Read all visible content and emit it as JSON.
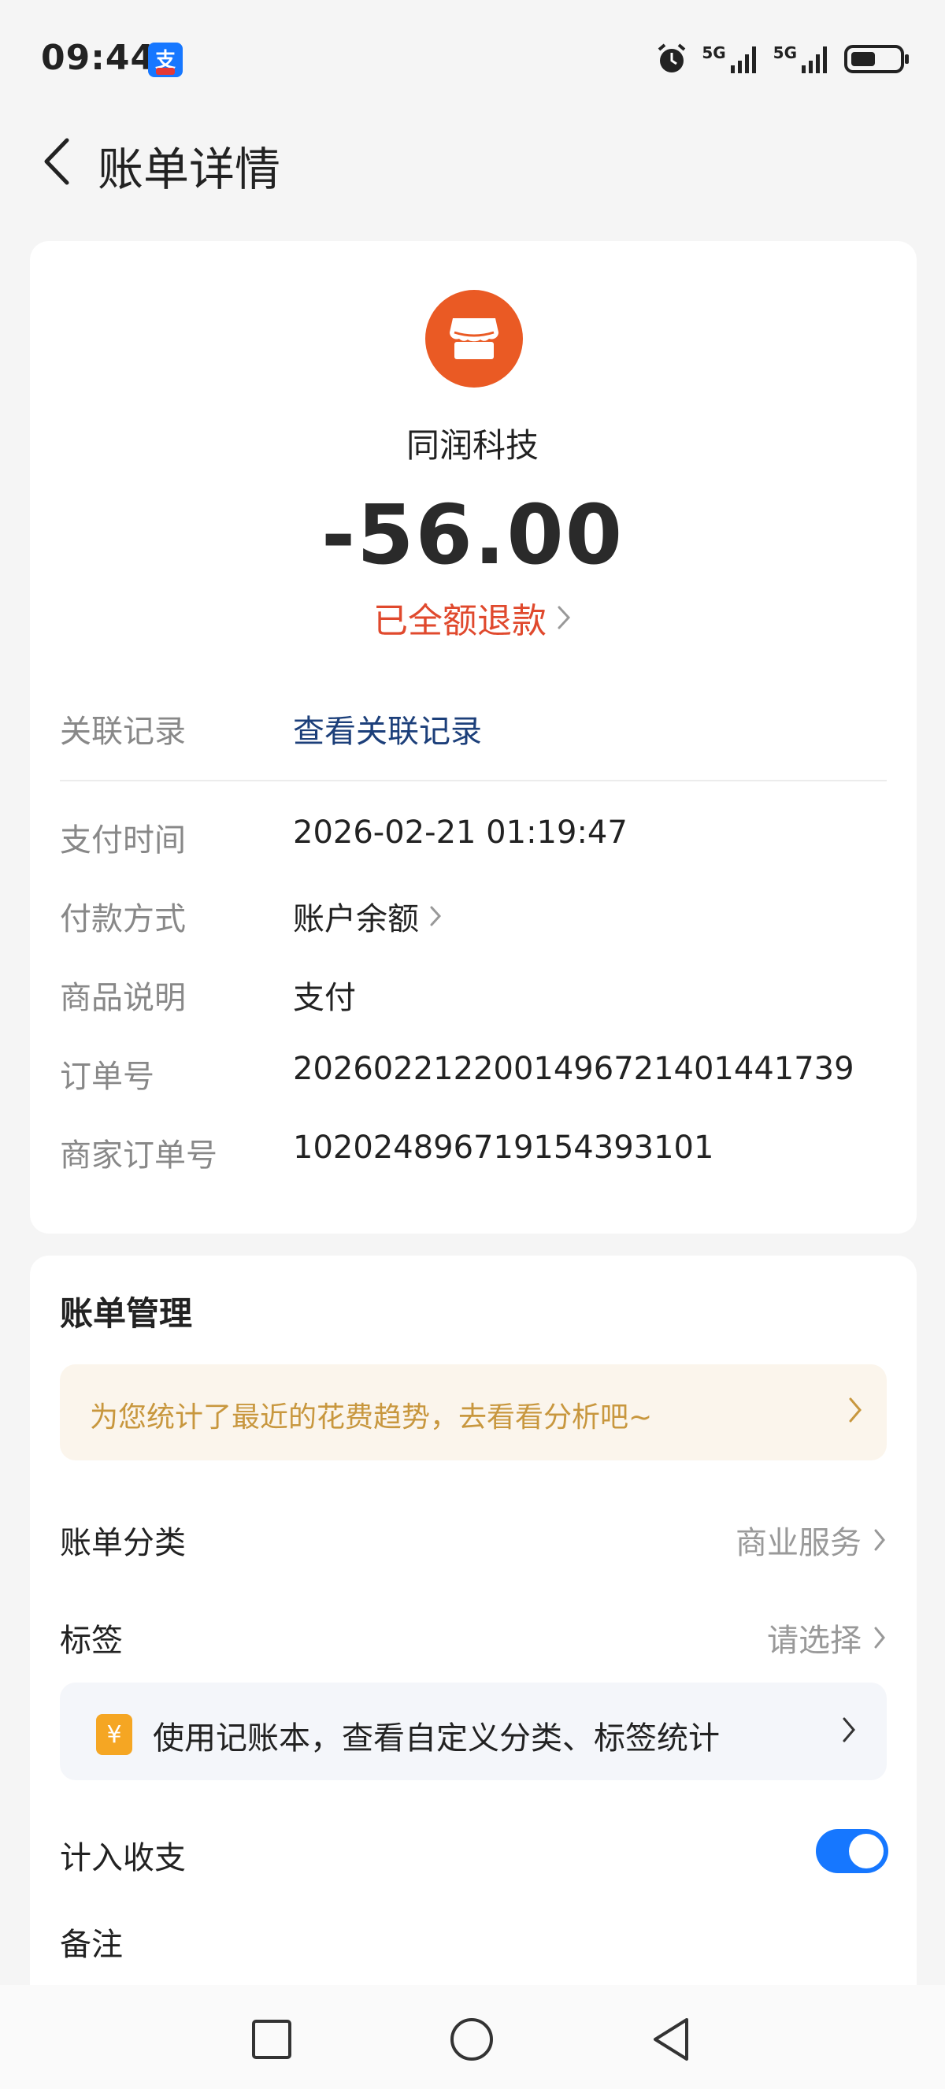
{
  "status_bar": {
    "time": "09:44",
    "app_badge_label": "支",
    "signal_1": "5G",
    "signal_2": "5G"
  },
  "header": {
    "title": "账单详情"
  },
  "bill": {
    "merchant_name": "同润科技",
    "amount": "-56.00",
    "refund_status": "已全额退款",
    "related_label": "关联记录",
    "related_value": "查看关联记录",
    "details": [
      {
        "label": "支付时间",
        "value": "2026-02-21 01:19:47"
      },
      {
        "label": "付款方式",
        "value": "账户余额"
      },
      {
        "label": "商品说明",
        "value": "支付"
      },
      {
        "label": "订单号",
        "value": "2026022122001496721401441739"
      },
      {
        "label": "商家订单号",
        "value": "102024896719154393101"
      }
    ]
  },
  "management": {
    "title": "账单管理",
    "trend_tip": "为您统计了最近的花费趋势，去看看分析吧~",
    "category_label": "账单分类",
    "category_value": "商业服务",
    "tag_label": "标签",
    "tag_value": "请选择",
    "promo_text": "使用记账本，查看自定义分类、标签统计",
    "promo_icon_glyph": "¥",
    "include_label": "计入收支",
    "include_enabled": true,
    "remark_label": "备注"
  },
  "colors": {
    "accent_blue": "#1677ff",
    "refund_red": "#e0492d",
    "merchant_orange": "#ea5a24",
    "tip_gold": "#c8973e"
  },
  "icons": {
    "back": "chevron-left-icon",
    "merchant": "store-icon",
    "nav_recent": "square-icon",
    "nav_home": "circle-icon",
    "nav_back": "triangle-back-icon"
  }
}
